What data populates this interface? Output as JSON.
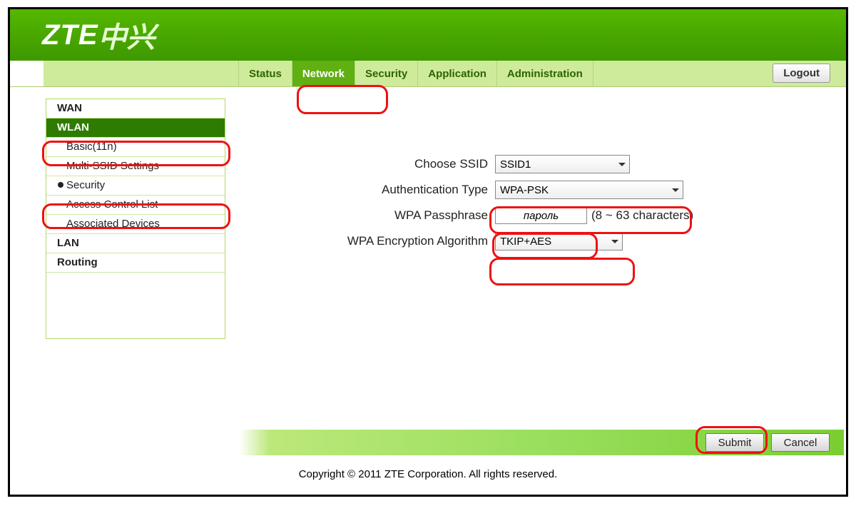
{
  "header": {
    "brand_en": "ZTE",
    "brand_cn": "中兴"
  },
  "tabs": {
    "status": "Status",
    "network": "Network",
    "security": "Security",
    "application": "Application",
    "administration": "Administration",
    "logout": "Logout"
  },
  "sidebar": {
    "wan": "WAN",
    "wlan": "WLAN",
    "basic": "Basic(11n)",
    "multi_ssid": "Multi-SSID Settings",
    "security": "Security",
    "acl": "Access Control List",
    "assoc": "Associated Devices",
    "lan": "LAN",
    "routing": "Routing"
  },
  "form": {
    "choose_ssid_label": "Choose SSID",
    "choose_ssid_value": "SSID1",
    "auth_type_label": "Authentication Type",
    "auth_type_value": "WPA-PSK",
    "passphrase_label": "WPA Passphrase",
    "passphrase_value": "пароль",
    "passphrase_hint": "(8 ~ 63 characters)",
    "enc_algo_label": "WPA Encryption Algorithm",
    "enc_algo_value": "TKIP+AES"
  },
  "buttons": {
    "submit": "Submit",
    "cancel": "Cancel"
  },
  "footer": {
    "copyright": "Copyright © 2011 ZTE Corporation. All rights reserved."
  }
}
